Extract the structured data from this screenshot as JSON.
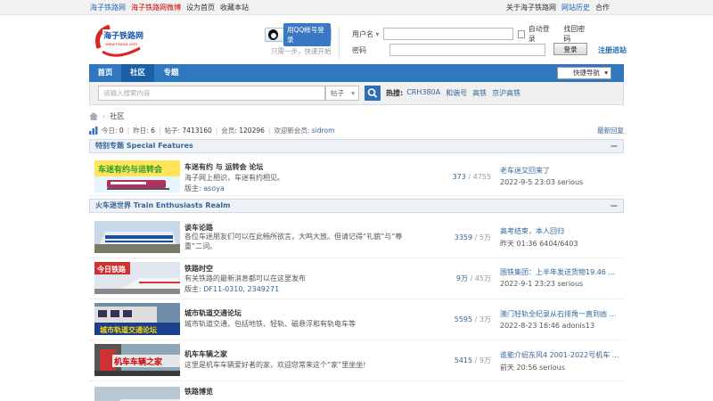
{
  "topbar": {
    "links_left": [
      {
        "label": "海子铁路网",
        "color": "#2266bb"
      },
      {
        "label": "海子铁路网微博",
        "color": "#cc0000"
      },
      {
        "label": "设为首页",
        "color": "#333333"
      },
      {
        "label": "收藏本站",
        "color": "#333333"
      }
    ],
    "links_right": [
      {
        "label": "关于海子铁路网",
        "color": "#333333"
      },
      {
        "label": "网站历史",
        "color": "#2266bb"
      },
      {
        "label": "合作",
        "color": "#333333"
      }
    ]
  },
  "logo": {
    "text": "海子铁路网",
    "sub": "www.hiwoo.com"
  },
  "qq_login": {
    "label": "用QQ帐号登录",
    "hint": "只需一步，快速开始"
  },
  "login": {
    "username_label": "用户名",
    "password_label": "密码",
    "auto_login_label": "自动登录",
    "find_password": "找回密码",
    "login_button": "登录",
    "register": "注册进站"
  },
  "nav": {
    "tabs": [
      {
        "label": "首页",
        "current": false
      },
      {
        "label": "社区",
        "current": true
      },
      {
        "label": "专题",
        "current": false
      }
    ],
    "quick_nav": "快捷导航"
  },
  "search": {
    "placeholder": "请输入搜索内容",
    "type": "帖子",
    "hot_label": "热搜:",
    "hot_terms": [
      "CRH380A",
      "和谐号",
      "高铁",
      "京沪高铁"
    ]
  },
  "breadcrumb": {
    "current": "社区"
  },
  "stats": {
    "today_label": "今日:",
    "today": "0",
    "yesterday_label": "昨日:",
    "yesterday": "6",
    "posts_label": "帖子:",
    "posts": "7413160",
    "members_label": "会员:",
    "members": "120296",
    "welcome_label": "欢迎新会员:",
    "newest": "sidrom",
    "latest_reply": "最新回复"
  },
  "sections": [
    {
      "title": "特别专题 Special Features",
      "forums": [
        {
          "name": "车迷有约 与 运转会 论坛",
          "desc": "海子网上相识，车迷有约相见。",
          "mod_label": "版主:",
          "mod": "asoya",
          "threads": "373",
          "posts": "4755",
          "last_title": "老车迷又回来了",
          "last_meta": "2022-9-5 23:03 serious",
          "thumb": "banner-yunzhuan"
        }
      ]
    },
    {
      "title": "火车迷世界 Train Enthusiasts Realm",
      "forums": [
        {
          "name": "谈车论路",
          "desc": "各位车迷朋友们可以在此畅所欲言，大鸣大放。但请记得“礼貌”与“尊重”二词。",
          "mod_label": "",
          "mod": "",
          "threads": "3359",
          "posts": "5万",
          "last_title": "高考结束，本人回归",
          "last_meta": "昨天 01:36 6404/6403",
          "thumb": "train-photo"
        },
        {
          "name": "铁路时空",
          "desc": "有关铁路的最新消息都可以在这里发布",
          "mod_label": "版主:",
          "mod": "DF11-0310, 2349271",
          "threads": "9万",
          "posts": "45万",
          "last_title": "国铁集团：上半年发送货物19.46 ...",
          "last_meta": "2022-9-1 23:23 serious",
          "thumb": "banner-jinri"
        },
        {
          "name": "城市轨道交通论坛",
          "desc": "城市轨道交通，包括地铁、轻轨、磁悬浮和有轨电车等",
          "mod_label": "",
          "mod": "",
          "threads": "5595",
          "posts": "3万",
          "last_title": "澳门轻轨全纪录从石排角一直到凼 ...",
          "last_meta": "2022-8-23 16:46 adonis13",
          "thumb": "banner-metro"
        },
        {
          "name": "机车车辆之家",
          "desc": "这里是机车车辆爱好者的家，欢迎您常来这个“家”里坐坐!",
          "mod_label": "",
          "mod": "",
          "threads": "5415",
          "posts": "9万",
          "last_title": "谁能介绍东风4 2001-2022号机车 ...",
          "last_meta": "前天 20:56 serious",
          "thumb": "banner-jiche"
        },
        {
          "name": "铁路博览",
          "desc": "",
          "mod_label": "",
          "mod": "",
          "threads": "",
          "posts": "",
          "last_title": "",
          "last_meta": "",
          "thumb": "train-photo-2"
        }
      ]
    }
  ]
}
